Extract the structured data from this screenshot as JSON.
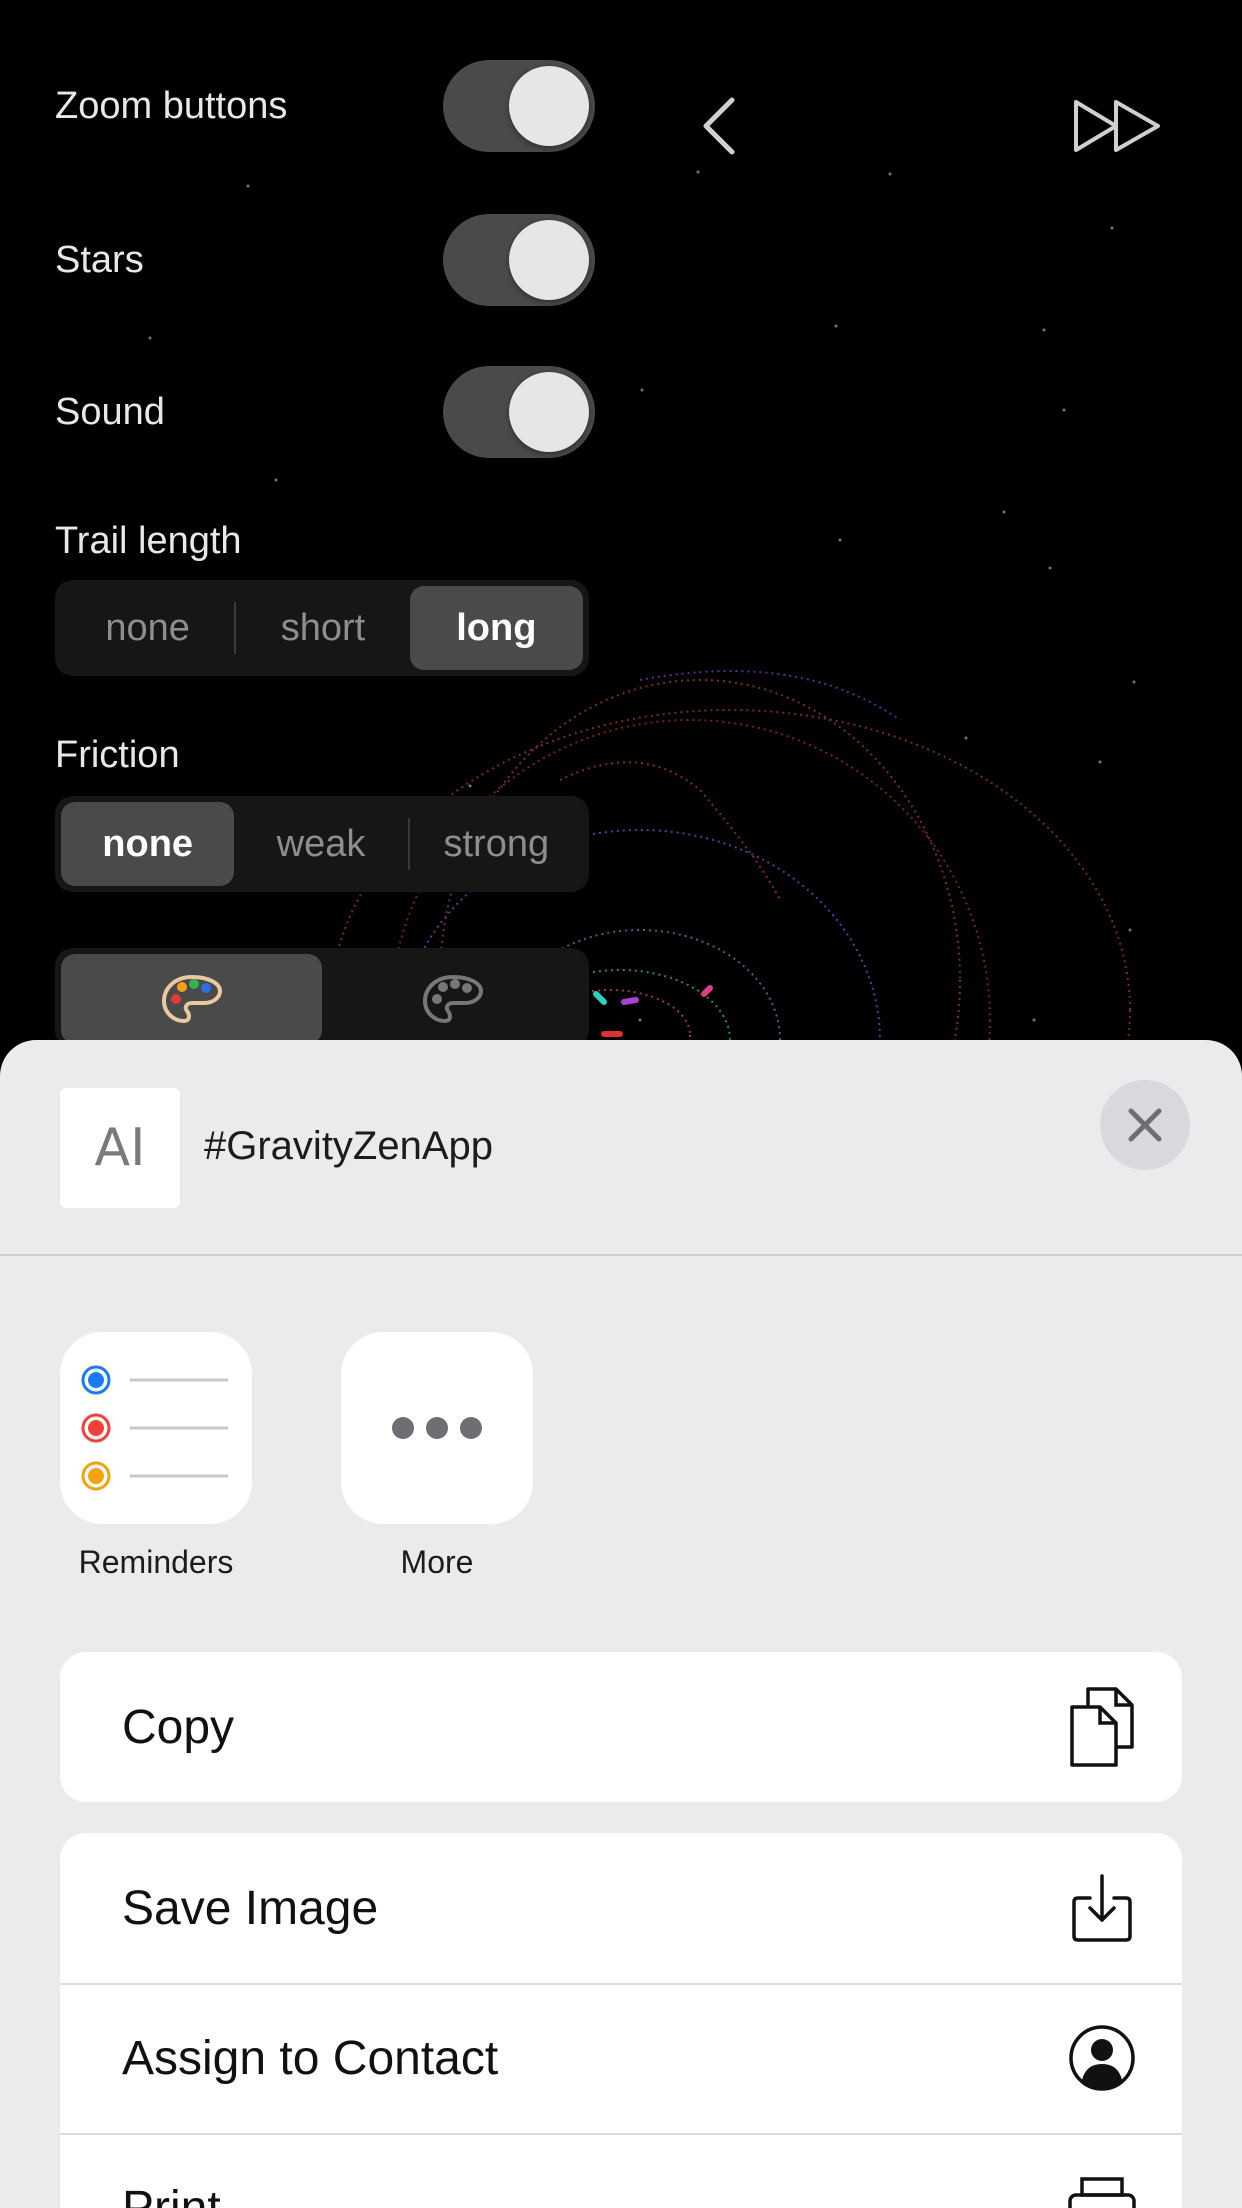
{
  "settings": {
    "zoom_buttons": {
      "label": "Zoom buttons",
      "on": true
    },
    "stars": {
      "label": "Stars",
      "on": true
    },
    "sound": {
      "label": "Sound",
      "on": true
    }
  },
  "trail_length": {
    "label": "Trail length",
    "options": [
      "none",
      "short",
      "long"
    ],
    "selected": "long"
  },
  "friction": {
    "label": "Friction",
    "options": [
      "none",
      "weak",
      "strong"
    ],
    "selected": "none"
  },
  "color_scheme": {
    "options": [
      "colorful-palette-icon",
      "monochrome-palette-icon"
    ],
    "selected": "colorful-palette-icon"
  },
  "nav": {
    "back_icon": "chevron-left-icon",
    "fast_forward_icon": "fast-forward-icon"
  },
  "share_sheet": {
    "preview_icon": "text-icon",
    "preview_icon_glyph": "AI",
    "title": "#GravityZenApp",
    "apps": [
      {
        "label": "Reminders",
        "icon": "reminders-icon"
      },
      {
        "label": "More",
        "icon": "more-icon"
      }
    ],
    "actions": {
      "copy": {
        "label": "Copy",
        "icon": "copy-icon"
      },
      "save_image": {
        "label": "Save Image",
        "icon": "save-image-icon"
      },
      "assign_contact": {
        "label": "Assign to Contact",
        "icon": "contact-icon"
      },
      "print": {
        "label": "Print",
        "icon": "print-icon"
      }
    }
  },
  "colors": {
    "sheet_bg": "#ebeaec",
    "toggle_track": "#4a4a4a",
    "reminder_blue": "#1a7cf2",
    "reminder_red": "#f2403a",
    "reminder_orange": "#f7a10c"
  }
}
